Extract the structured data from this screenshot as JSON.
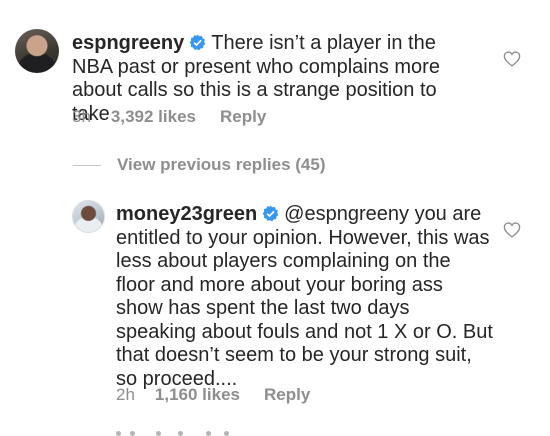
{
  "comment_1": {
    "username": "espngreeny",
    "verified_icon": "verified-badge-icon",
    "text": "There isn’t a player in the NBA past or present who complains more about calls so this is a strange position to take",
    "time": "3h",
    "likes": "3,392 likes",
    "reply_label": "Reply",
    "like_icon": "heart-outline-icon"
  },
  "view_previous_replies": "View previous replies (45)",
  "comment_2": {
    "username": "money23green",
    "verified_icon": "verified-badge-icon",
    "mention": "@espngreeny",
    "text": "you are entitled to your opinion. However, this was less about players complaining on the floor and more about your boring ass show has spent the last two days speaking about fouls and not 1 X or O. But that doesn’t seem to be your strong suit, so proceed....",
    "time": "2h",
    "likes": "1,160 likes",
    "reply_label": "Reply",
    "like_icon": "heart-outline-icon"
  },
  "colors": {
    "text": "#262626",
    "secondary": "#8e8e8e",
    "verified": "#3897f0",
    "background": "#ffffff"
  }
}
